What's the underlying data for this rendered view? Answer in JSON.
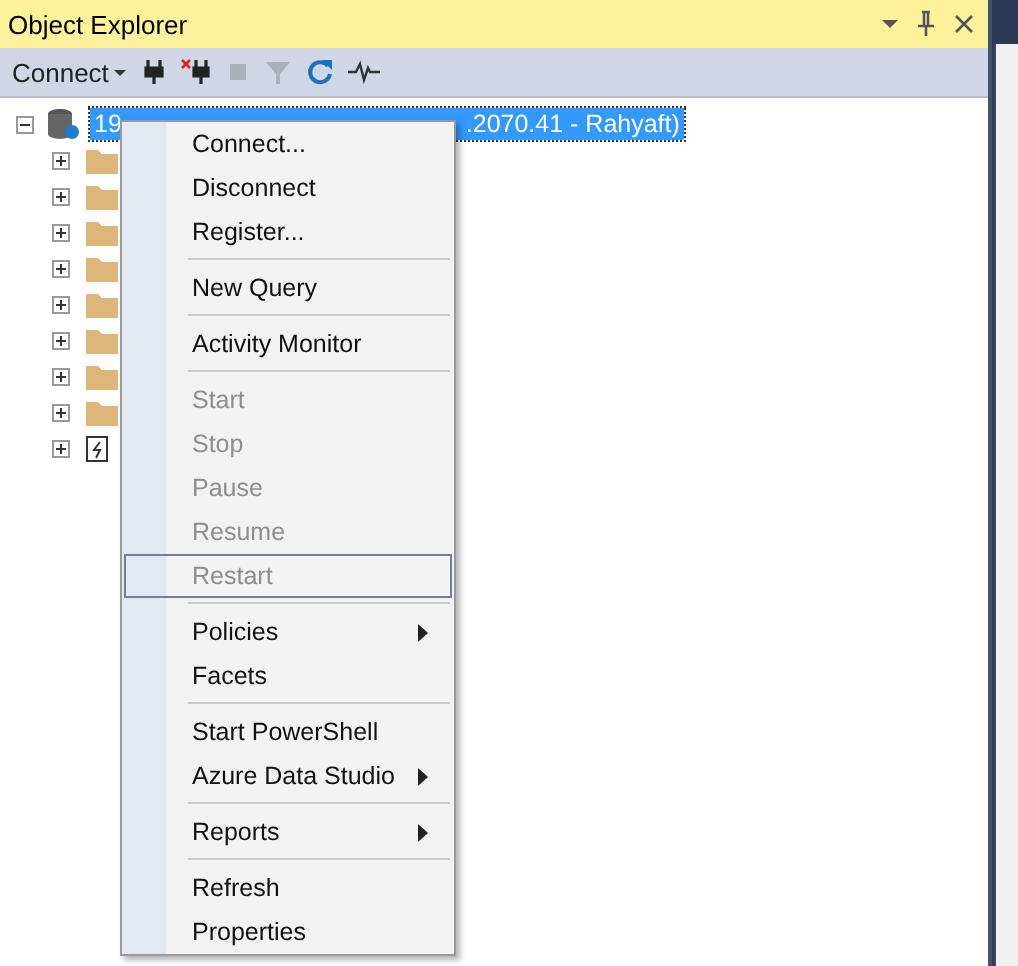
{
  "panel": {
    "title": "Object Explorer"
  },
  "toolbar": {
    "connect_label": "Connect"
  },
  "tree": {
    "server": {
      "expanded": true,
      "selected": true,
      "label_before_menu": "19",
      "label_after_menu": ".2070.41 - Rahyaft)"
    },
    "children": [
      {
        "kind": "folder",
        "expanded": false
      },
      {
        "kind": "folder",
        "expanded": false
      },
      {
        "kind": "folder",
        "expanded": false
      },
      {
        "kind": "folder",
        "expanded": false
      },
      {
        "kind": "folder",
        "expanded": false
      },
      {
        "kind": "folder",
        "expanded": false
      },
      {
        "kind": "folder",
        "expanded": false
      },
      {
        "kind": "folder",
        "expanded": false
      },
      {
        "kind": "agent",
        "expanded": false
      }
    ]
  },
  "context_menu": [
    {
      "kind": "item",
      "label": "Connect...",
      "disabled": false,
      "highlighted": false,
      "submenu": false
    },
    {
      "kind": "item",
      "label": "Disconnect",
      "disabled": false,
      "highlighted": false,
      "submenu": false
    },
    {
      "kind": "item",
      "label": "Register...",
      "disabled": false,
      "highlighted": false,
      "submenu": false
    },
    {
      "kind": "separator"
    },
    {
      "kind": "item",
      "label": "New Query",
      "disabled": false,
      "highlighted": false,
      "submenu": false
    },
    {
      "kind": "separator"
    },
    {
      "kind": "item",
      "label": "Activity Monitor",
      "disabled": false,
      "highlighted": false,
      "submenu": false
    },
    {
      "kind": "separator"
    },
    {
      "kind": "item",
      "label": "Start",
      "disabled": true,
      "highlighted": false,
      "submenu": false
    },
    {
      "kind": "item",
      "label": "Stop",
      "disabled": true,
      "highlighted": false,
      "submenu": false
    },
    {
      "kind": "item",
      "label": "Pause",
      "disabled": true,
      "highlighted": false,
      "submenu": false
    },
    {
      "kind": "item",
      "label": "Resume",
      "disabled": true,
      "highlighted": false,
      "submenu": false
    },
    {
      "kind": "item",
      "label": "Restart",
      "disabled": true,
      "highlighted": true,
      "submenu": false
    },
    {
      "kind": "separator"
    },
    {
      "kind": "item",
      "label": "Policies",
      "disabled": false,
      "highlighted": false,
      "submenu": true
    },
    {
      "kind": "item",
      "label": "Facets",
      "disabled": false,
      "highlighted": false,
      "submenu": false
    },
    {
      "kind": "separator"
    },
    {
      "kind": "item",
      "label": "Start PowerShell",
      "disabled": false,
      "highlighted": false,
      "submenu": false
    },
    {
      "kind": "item",
      "label": "Azure Data Studio",
      "disabled": false,
      "highlighted": false,
      "submenu": true
    },
    {
      "kind": "separator"
    },
    {
      "kind": "item",
      "label": "Reports",
      "disabled": false,
      "highlighted": false,
      "submenu": true
    },
    {
      "kind": "separator"
    },
    {
      "kind": "item",
      "label": "Refresh",
      "disabled": false,
      "highlighted": false,
      "submenu": false
    },
    {
      "kind": "item",
      "label": "Properties",
      "disabled": false,
      "highlighted": false,
      "submenu": false
    }
  ]
}
